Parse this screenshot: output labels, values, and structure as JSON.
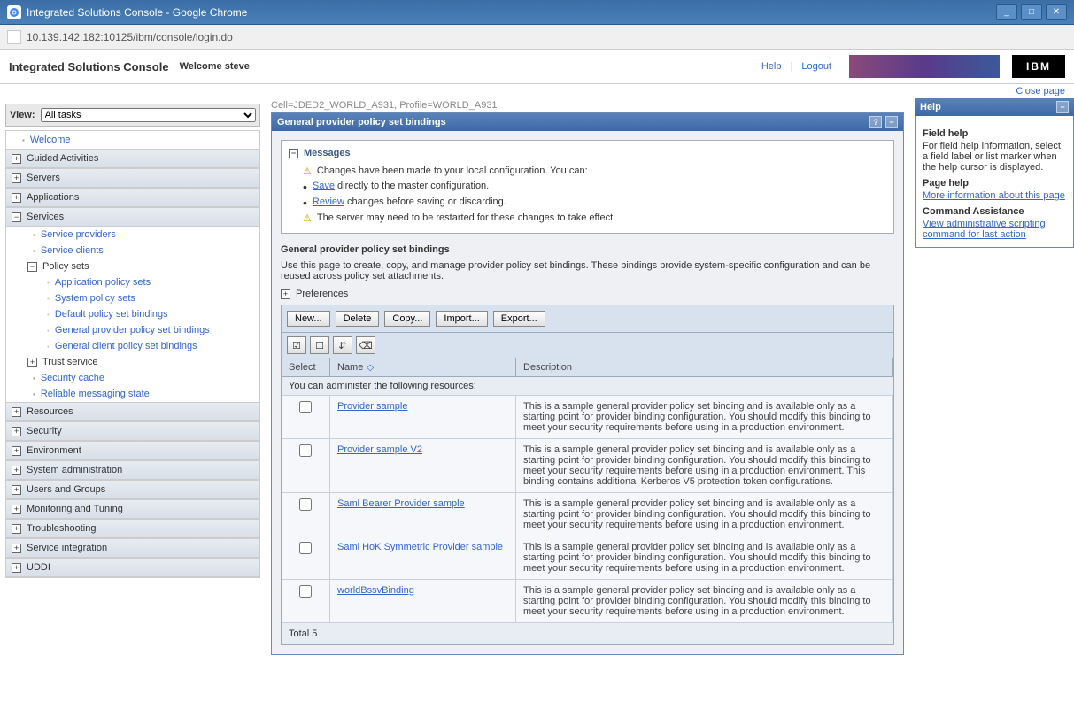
{
  "browser": {
    "title": "Integrated Solutions Console - Google Chrome",
    "url": "10.139.142.182:10125/ibm/console/login.do"
  },
  "header": {
    "app_title": "Integrated Solutions Console",
    "welcome": "Welcome steve",
    "help": "Help",
    "logout": "Logout",
    "ibm": "IBM",
    "close_page": "Close page"
  },
  "nav": {
    "view_label": "View:",
    "view_value": "All tasks",
    "welcome": "Welcome",
    "sections": {
      "guided": "Guided Activities",
      "servers": "Servers",
      "applications": "Applications",
      "services": "Services",
      "resources": "Resources",
      "security": "Security",
      "environment": "Environment",
      "sysadmin": "System administration",
      "users": "Users and Groups",
      "monitoring": "Monitoring and Tuning",
      "troubleshooting": "Troubleshooting",
      "serviceint": "Service integration",
      "uddi": "UDDI"
    },
    "services": {
      "providers": "Service providers",
      "clients": "Service clients",
      "policy_sets": "Policy sets",
      "app_policy": "Application policy sets",
      "sys_policy": "System policy sets",
      "default_bind": "Default policy set bindings",
      "gen_prov_bind": "General provider policy set bindings",
      "gen_client_bind": "General client policy set bindings",
      "trust": "Trust service",
      "security_cache": "Security cache",
      "reliable": "Reliable messaging state"
    }
  },
  "main": {
    "cell_info": "Cell=JDED2_WORLD_A931, Profile=WORLD_A931",
    "panel_title": "General provider policy set bindings",
    "messages": {
      "header": "Messages",
      "line1": "Changes have been made to your local configuration. You can:",
      "save_link": "Save",
      "save_rest": " directly to the master configuration.",
      "review_link": "Review",
      "review_rest": " changes before saving or discarding.",
      "restart": "The server may need to be restarted for these changes to take effect."
    },
    "section_title": "General provider policy set bindings",
    "section_desc": "Use this page to create, copy, and manage provider policy set bindings. These bindings provide system-specific configuration and can be reused across policy set attachments.",
    "preferences": "Preferences",
    "buttons": {
      "new": "New...",
      "delete": "Delete",
      "copy": "Copy...",
      "import": "Import...",
      "export": "Export..."
    },
    "columns": {
      "select": "Select",
      "name": "Name",
      "description": "Description"
    },
    "admin_text": "You can administer the following resources:",
    "rows": [
      {
        "name": "Provider sample",
        "desc": "This is a sample general provider policy set binding and is available only as a starting point for provider binding configuration. You should modify this binding to meet your security requirements before using in a production environment."
      },
      {
        "name": "Provider sample V2",
        "desc": "This is a sample general provider policy set binding and is available only as a starting point for provider binding configuration. You should modify this binding to meet your security requirements before using in a production environment. This binding contains additional Kerberos V5 protection token configurations."
      },
      {
        "name": "Saml Bearer Provider sample",
        "desc": "This is a sample general provider policy set binding and is available only as a starting point for provider binding configuration. You should modify this binding to meet your security requirements before using in a production environment."
      },
      {
        "name": "Saml HoK Symmetric Provider sample",
        "desc": "This is a sample general provider policy set binding and is available only as a starting point for provider binding configuration. You should modify this binding to meet your security requirements before using in a production environment."
      },
      {
        "name": "worldBssvBinding",
        "desc": "This is a sample general provider policy set binding and is available only as a starting point for provider binding configuration. You should modify this binding to meet your security requirements before using in a production environment."
      }
    ],
    "total": "Total 5"
  },
  "help": {
    "title": "Help",
    "field_help": "Field help",
    "field_help_text": "For field help information, select a field label or list marker when the help cursor is displayed.",
    "page_help": "Page help",
    "page_help_link": "More information about this page",
    "cmd_assist": "Command Assistance",
    "cmd_link": "View administrative scripting command for last action"
  }
}
